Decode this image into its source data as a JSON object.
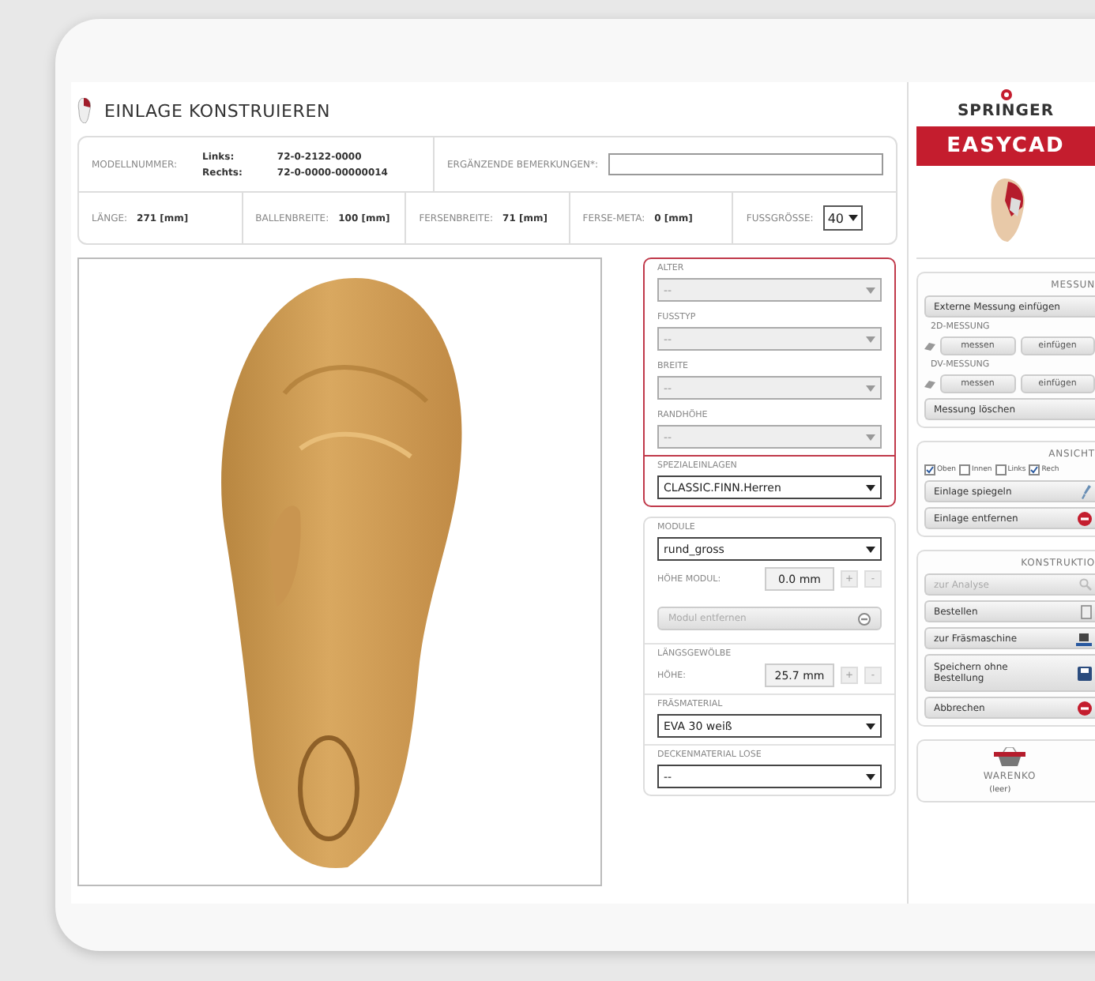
{
  "header": {
    "title": "EINLAGE KONSTRUIEREN"
  },
  "info": {
    "model_label": "MODELLNUMMER:",
    "model_rows": [
      {
        "side": "Links:",
        "number": "72-0-2122-0000"
      },
      {
        "side": "Rechts:",
        "number": "72-0-0000-00000014"
      }
    ],
    "remarks_label": "ERGÄNZENDE BEMERKUNGEN*:",
    "measures": [
      {
        "label": "LÄNGE:",
        "value": "271 [mm]"
      },
      {
        "label": "BALLENBREITE:",
        "value": "100 [mm]"
      },
      {
        "label": "FERSENBREITE:",
        "value": "71 [mm]"
      },
      {
        "label": "FERSE-META:",
        "value": "0 [mm]"
      }
    ],
    "size": {
      "label": "FUSSGRÖSSE:",
      "value": "40"
    }
  },
  "form": {
    "profile": [
      {
        "label": "ALTER",
        "value": "--",
        "disabled": true
      },
      {
        "label": "FUSSTYP",
        "value": "--",
        "disabled": true
      },
      {
        "label": "BREITE",
        "value": "--",
        "disabled": true
      },
      {
        "label": "RANDHÖHE",
        "value": "--",
        "disabled": true
      }
    ],
    "special": {
      "label": "SPEZIALEINLAGEN",
      "value": "CLASSIC.FINN.Herren",
      "disabled": false
    },
    "module": {
      "label": "MODULE",
      "value": "rund_gross",
      "height_label": "HÖHE MODUL:",
      "height": "0.0 mm",
      "plus": "+",
      "minus": "-",
      "remove": "Modul entfernen",
      "remove_disabled": true
    },
    "arch": {
      "label": "LÄNGSGEWÖLBE",
      "height_label": "HÖHE:",
      "height": "25.7 mm",
      "plus": "+",
      "minus": "-"
    },
    "selects": [
      {
        "label": "FRÄSMATERIAL",
        "value": "EVA 30 weiß",
        "disabled": false
      },
      {
        "label": "DECKENMATERIAL LOSE",
        "value": "--",
        "disabled": false
      }
    ]
  },
  "panel": {
    "brand": "SPRINGER",
    "product": "EASYCAD",
    "measure": {
      "heading": "MESSUN",
      "external": "Externe Messung einfügen",
      "groups": [
        {
          "title": "2D-MESSUNG",
          "buttons": [
            "messen",
            "einfügen"
          ]
        },
        {
          "title": "DV-MESSUNG",
          "buttons": [
            "messen",
            "einfügen"
          ]
        }
      ],
      "delete": "Messung löschen"
    },
    "view": {
      "heading": "ANSICHT",
      "checks": [
        {
          "label": "Oben",
          "checked": true
        },
        {
          "label": "Innen",
          "checked": false
        },
        {
          "label": "Links",
          "checked": false
        },
        {
          "label": "Rech",
          "checked": true
        }
      ],
      "buttons": [
        {
          "label": "Einlage spiegeln",
          "kind": "mirror",
          "disabled": false
        },
        {
          "label": "Einlage entfernen",
          "kind": "remove",
          "disabled": false
        }
      ]
    },
    "construct": {
      "heading": "KONSTRUKTIO",
      "buttons": [
        {
          "label": "zur Analyse",
          "kind": "analyse",
          "disabled": true
        },
        {
          "label": "Bestellen",
          "kind": "order",
          "disabled": false
        },
        {
          "label": "zur Fräsmaschine",
          "kind": "mill",
          "disabled": false
        },
        {
          "label": "Speichern ohne Bestellung",
          "kind": "save",
          "disabled": false
        },
        {
          "label": "Abbrechen",
          "kind": "cancel",
          "disabled": false
        }
      ]
    },
    "cart": {
      "heading": "WARENKO",
      "status": "(leer)"
    }
  }
}
